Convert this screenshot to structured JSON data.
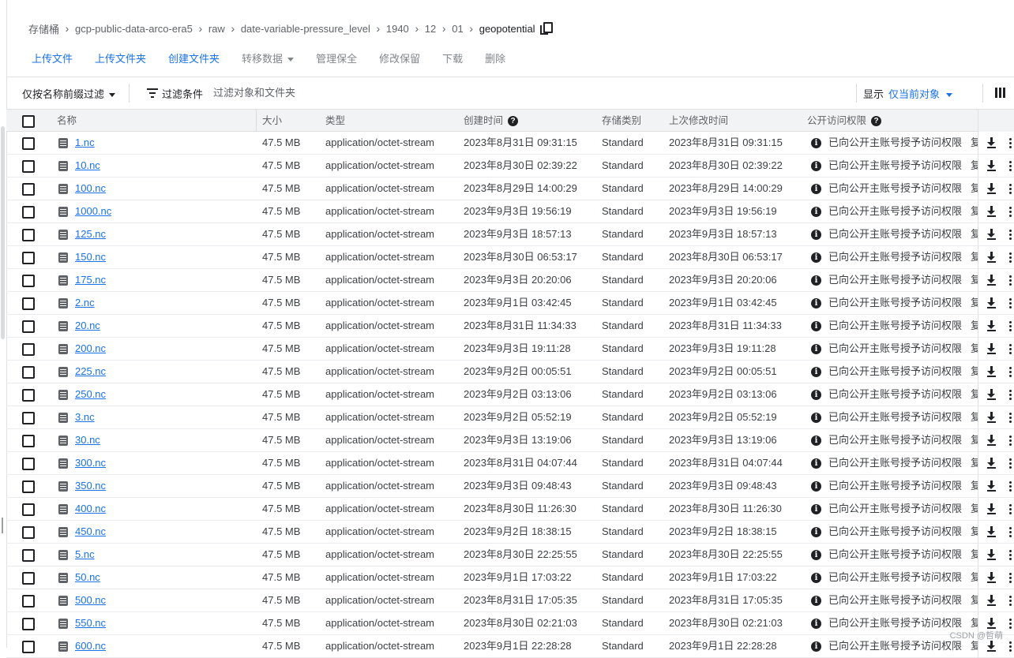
{
  "breadcrumb": {
    "items": [
      "存储桶",
      "gcp-public-data-arco-era5",
      "raw",
      "date-variable-pressure_level",
      "1940",
      "12",
      "01"
    ],
    "current": "geopotential",
    "separator": "›"
  },
  "toolbar": {
    "upload_files": "上传文件",
    "upload_folder": "上传文件夹",
    "create_folder": "创建文件夹",
    "transfer_data": "转移数据",
    "manage_holds": "管理保全",
    "edit_retention": "修改保留",
    "download": "下载",
    "delete": "删除"
  },
  "filterbar": {
    "prefix_filter": "仅按名称前缀过滤",
    "filter_label": "过滤条件",
    "filter_placeholder": "过滤对象和文件夹",
    "display_label": "显示",
    "display_value": "仅当前对象"
  },
  "table": {
    "headers": {
      "name": "名称",
      "size": "大小",
      "type": "类型",
      "created": "创建时间",
      "storage_class": "存储类别",
      "modified": "上次修改时间",
      "public_access": "公开访问权限"
    },
    "rows": [
      {
        "name": "1.nc",
        "size": "47.5 MB",
        "type": "application/octet-stream",
        "created": "2023年8月31日 09:31:15",
        "storage_class": "Standard",
        "modified": "2023年8月31日 09:31:15",
        "access": "已向公开主账号授予访问权限",
        "more": "复"
      },
      {
        "name": "10.nc",
        "size": "47.5 MB",
        "type": "application/octet-stream",
        "created": "2023年8月30日 02:39:22",
        "storage_class": "Standard",
        "modified": "2023年8月30日 02:39:22",
        "access": "已向公开主账号授予访问权限",
        "more": "复"
      },
      {
        "name": "100.nc",
        "size": "47.5 MB",
        "type": "application/octet-stream",
        "created": "2023年8月29日 14:00:29",
        "storage_class": "Standard",
        "modified": "2023年8月29日 14:00:29",
        "access": "已向公开主账号授予访问权限",
        "more": "复"
      },
      {
        "name": "1000.nc",
        "size": "47.5 MB",
        "type": "application/octet-stream",
        "created": "2023年9月3日 19:56:19",
        "storage_class": "Standard",
        "modified": "2023年9月3日 19:56:19",
        "access": "已向公开主账号授予访问权限",
        "more": "复"
      },
      {
        "name": "125.nc",
        "size": "47.5 MB",
        "type": "application/octet-stream",
        "created": "2023年9月3日 18:57:13",
        "storage_class": "Standard",
        "modified": "2023年9月3日 18:57:13",
        "access": "已向公开主账号授予访问权限",
        "more": "复"
      },
      {
        "name": "150.nc",
        "size": "47.5 MB",
        "type": "application/octet-stream",
        "created": "2023年8月30日 06:53:17",
        "storage_class": "Standard",
        "modified": "2023年8月30日 06:53:17",
        "access": "已向公开主账号授予访问权限",
        "more": "复"
      },
      {
        "name": "175.nc",
        "size": "47.5 MB",
        "type": "application/octet-stream",
        "created": "2023年9月3日 20:20:06",
        "storage_class": "Standard",
        "modified": "2023年9月3日 20:20:06",
        "access": "已向公开主账号授予访问权限",
        "more": "复"
      },
      {
        "name": "2.nc",
        "size": "47.5 MB",
        "type": "application/octet-stream",
        "created": "2023年9月1日 03:42:45",
        "storage_class": "Standard",
        "modified": "2023年9月1日 03:42:45",
        "access": "已向公开主账号授予访问权限",
        "more": "复"
      },
      {
        "name": "20.nc",
        "size": "47.5 MB",
        "type": "application/octet-stream",
        "created": "2023年8月31日 11:34:33",
        "storage_class": "Standard",
        "modified": "2023年8月31日 11:34:33",
        "access": "已向公开主账号授予访问权限",
        "more": "复"
      },
      {
        "name": "200.nc",
        "size": "47.5 MB",
        "type": "application/octet-stream",
        "created": "2023年9月3日 19:11:28",
        "storage_class": "Standard",
        "modified": "2023年9月3日 19:11:28",
        "access": "已向公开主账号授予访问权限",
        "more": "复"
      },
      {
        "name": "225.nc",
        "size": "47.5 MB",
        "type": "application/octet-stream",
        "created": "2023年9月2日 00:05:51",
        "storage_class": "Standard",
        "modified": "2023年9月2日 00:05:51",
        "access": "已向公开主账号授予访问权限",
        "more": "复"
      },
      {
        "name": "250.nc",
        "size": "47.5 MB",
        "type": "application/octet-stream",
        "created": "2023年9月2日 03:13:06",
        "storage_class": "Standard",
        "modified": "2023年9月2日 03:13:06",
        "access": "已向公开主账号授予访问权限",
        "more": "复"
      },
      {
        "name": "3.nc",
        "size": "47.5 MB",
        "type": "application/octet-stream",
        "created": "2023年9月2日 05:52:19",
        "storage_class": "Standard",
        "modified": "2023年9月2日 05:52:19",
        "access": "已向公开主账号授予访问权限",
        "more": "复"
      },
      {
        "name": "30.nc",
        "size": "47.5 MB",
        "type": "application/octet-stream",
        "created": "2023年9月3日 13:19:06",
        "storage_class": "Standard",
        "modified": "2023年9月3日 13:19:06",
        "access": "已向公开主账号授予访问权限",
        "more": "复"
      },
      {
        "name": "300.nc",
        "size": "47.5 MB",
        "type": "application/octet-stream",
        "created": "2023年8月31日 04:07:44",
        "storage_class": "Standard",
        "modified": "2023年8月31日 04:07:44",
        "access": "已向公开主账号授予访问权限",
        "more": "复"
      },
      {
        "name": "350.nc",
        "size": "47.5 MB",
        "type": "application/octet-stream",
        "created": "2023年9月3日 09:48:43",
        "storage_class": "Standard",
        "modified": "2023年9月3日 09:48:43",
        "access": "已向公开主账号授予访问权限",
        "more": "复"
      },
      {
        "name": "400.nc",
        "size": "47.5 MB",
        "type": "application/octet-stream",
        "created": "2023年8月30日 11:26:30",
        "storage_class": "Standard",
        "modified": "2023年8月30日 11:26:30",
        "access": "已向公开主账号授予访问权限",
        "more": "复"
      },
      {
        "name": "450.nc",
        "size": "47.5 MB",
        "type": "application/octet-stream",
        "created": "2023年9月2日 18:38:15",
        "storage_class": "Standard",
        "modified": "2023年9月2日 18:38:15",
        "access": "已向公开主账号授予访问权限",
        "more": "复"
      },
      {
        "name": "5.nc",
        "size": "47.5 MB",
        "type": "application/octet-stream",
        "created": "2023年8月30日 22:25:55",
        "storage_class": "Standard",
        "modified": "2023年8月30日 22:25:55",
        "access": "已向公开主账号授予访问权限",
        "more": "复"
      },
      {
        "name": "50.nc",
        "size": "47.5 MB",
        "type": "application/octet-stream",
        "created": "2023年9月1日 17:03:22",
        "storage_class": "Standard",
        "modified": "2023年9月1日 17:03:22",
        "access": "已向公开主账号授予访问权限",
        "more": "复"
      },
      {
        "name": "500.nc",
        "size": "47.5 MB",
        "type": "application/octet-stream",
        "created": "2023年8月31日 17:05:35",
        "storage_class": "Standard",
        "modified": "2023年8月31日 17:05:35",
        "access": "已向公开主账号授予访问权限",
        "more": "复"
      },
      {
        "name": "550.nc",
        "size": "47.5 MB",
        "type": "application/octet-stream",
        "created": "2023年8月30日 02:21:03",
        "storage_class": "Standard",
        "modified": "2023年8月30日 02:21:03",
        "access": "已向公开主账号授予访问权限",
        "more": "复"
      },
      {
        "name": "600.nc",
        "size": "47.5 MB",
        "type": "application/octet-stream",
        "created": "2023年9月1日 22:28:28",
        "storage_class": "Standard",
        "modified": "2023年9月1日 22:28:28",
        "access": "已向公开主账号授予访问权限",
        "more": "复"
      }
    ]
  },
  "icons": {
    "copy": "copy-icon",
    "filter": "filter-list-icon",
    "columns": "view-columns-icon",
    "help": "help-icon",
    "info": "info-icon",
    "file": "file-icon",
    "download": "download-icon",
    "more": "more-vert-icon"
  },
  "colors": {
    "accent": "#1a73e8",
    "header_bg": "#f1f3f4",
    "text": "#202124",
    "muted": "#5f6368"
  },
  "watermark": "CSDN @哲萌"
}
